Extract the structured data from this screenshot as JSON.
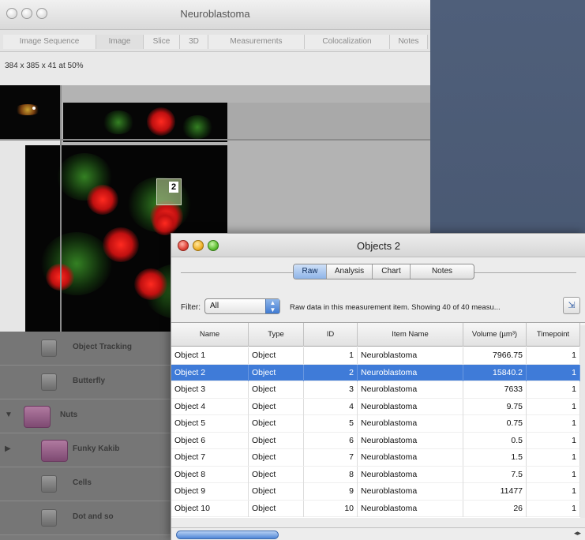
{
  "main_window": {
    "title": "Neuroblastoma",
    "tabs": [
      "Image Sequence",
      "Image",
      "Slice",
      "3D",
      "Measurements",
      "Colocalization",
      "Notes"
    ],
    "dimensions": "384 x 385 x 41 at 50%",
    "object_label": "2"
  },
  "sidebar": {
    "items": [
      {
        "label": "Object Tracking"
      },
      {
        "label": "Butterfly"
      },
      {
        "label": "Nuts"
      },
      {
        "label": "Funky Kakib"
      },
      {
        "label": "Cells"
      },
      {
        "label": "Dot and so"
      }
    ]
  },
  "objects_window": {
    "title": "Objects 2",
    "view_tabs": [
      "Raw",
      "Analysis",
      "Chart",
      "Notes"
    ],
    "selected_view_tab": "Raw",
    "filter_label": "Filter:",
    "filter_value": "All",
    "info_text": "Raw data in this measurement item.  Showing 40 of 40 measu...",
    "columns": [
      "Name",
      "Type",
      "ID",
      "Item Name",
      "Volume (µm³)",
      "Timepoint"
    ],
    "rows": [
      [
        "Object 1",
        "Object",
        "1",
        "Neuroblastoma",
        "7966.75",
        "1"
      ],
      [
        "Object 2",
        "Object",
        "2",
        "Neuroblastoma",
        "15840.2",
        "1"
      ],
      [
        "Object 3",
        "Object",
        "3",
        "Neuroblastoma",
        "7633",
        "1"
      ],
      [
        "Object 4",
        "Object",
        "4",
        "Neuroblastoma",
        "9.75",
        "1"
      ],
      [
        "Object 5",
        "Object",
        "5",
        "Neuroblastoma",
        "0.75",
        "1"
      ],
      [
        "Object 6",
        "Object",
        "6",
        "Neuroblastoma",
        "0.5",
        "1"
      ],
      [
        "Object 7",
        "Object",
        "7",
        "Neuroblastoma",
        "1.5",
        "1"
      ],
      [
        "Object 8",
        "Object",
        "8",
        "Neuroblastoma",
        "7.5",
        "1"
      ],
      [
        "Object 9",
        "Object",
        "9",
        "Neuroblastoma",
        "11477",
        "1"
      ],
      [
        "Object 10",
        "Object",
        "10",
        "Neuroblastoma",
        "26",
        "1"
      ]
    ],
    "selected_row": 1,
    "icons": {
      "export": "export-icon",
      "popup": "popup-arrows-icon"
    },
    "colors": {
      "selection": "#3f7bd8"
    }
  }
}
